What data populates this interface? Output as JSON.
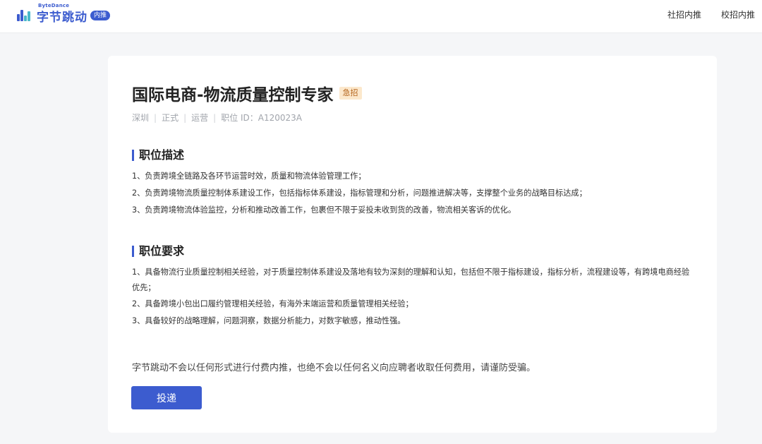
{
  "brand": {
    "sub": "ByteDance",
    "name": "字节跳动",
    "badge": "内推",
    "accent": "#3c5ccf"
  },
  "nav": {
    "items": [
      "社招内推",
      "校招内推"
    ]
  },
  "job": {
    "title": "国际电商-物流质量控制专家",
    "urgent_tag": "急招",
    "meta": [
      "深圳",
      "正式",
      "运营",
      "职位 ID：A120023A"
    ],
    "description": {
      "heading": "职位描述",
      "lines": [
        "1、负责跨境全链路及各环节运营时效，质量和物流体验管理工作；",
        "2、负责跨境物流质量控制体系建设工作，包括指标体系建设，指标管理和分析，问题推进解决等，支撑整个业务的战略目标达成；",
        "3、负责跨境物流体验监控，分析和推动改善工作，包裹但不限于妥投未收到货的改善，物流相关客诉的优化。"
      ]
    },
    "requirements": {
      "heading": "职位要求",
      "lines": [
        "1、具备物流行业质量控制相关经验，对于质量控制体系建设及落地有较为深刻的理解和认知，包括但不限于指标建设，指标分析，流程建设等，有跨境电商经验优先；",
        "2、具备跨境小包出口履约管理相关经验，有海外末端运营和质量管理相关经验；",
        "3、具备较好的战略理解，问题洞察，数据分析能力，对数字敏感，推动性强。"
      ]
    },
    "notice": "字节跳动不会以任何形式进行付费内推，也绝不会以任何名义向应聘者收取任何费用，请谨防受骗。",
    "apply_label": "投递"
  }
}
